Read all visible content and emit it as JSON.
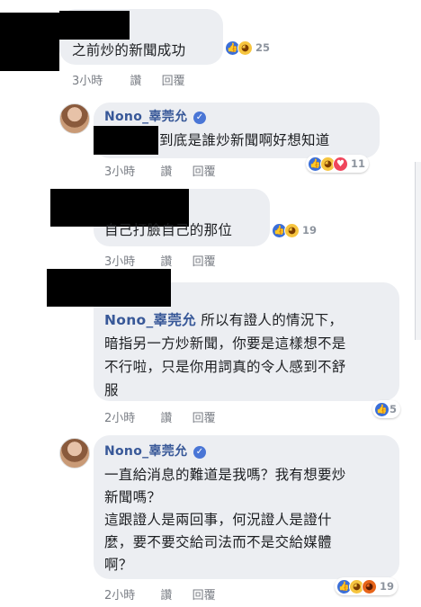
{
  "comments": [
    {
      "text": "之前炒的新聞成功",
      "time": "3小時",
      "like": "讚",
      "reply": "回覆",
      "reactions": [
        "like-icon",
        "haha-icon"
      ],
      "reaction_count": "25"
    },
    {
      "author": "Nono_辜莞允",
      "text": "到底是誰炒新聞啊好想知道",
      "time": "3小時",
      "like": "讚",
      "reply": "回覆",
      "reactions": [
        "like-icon",
        "haha-icon",
        "love-icon"
      ],
      "reaction_count": "11"
    },
    {
      "text": "自己打臉自己的那位",
      "time": "3小時",
      "like": "讚",
      "reply": "回覆",
      "reactions": [
        "like-icon",
        "haha-icon"
      ],
      "reaction_count": "19"
    },
    {
      "author": "Nono_辜莞允",
      "lines": [
        "所以有證人的情況下，",
        "暗指另一方炒新聞，你要是這樣想不是",
        "不行啦，只是你用詞真的令人感到不舒",
        "服"
      ],
      "time": "2小時",
      "like": "讚",
      "reply": "回覆",
      "reactions": [
        "like-icon"
      ],
      "reaction_count": "5"
    },
    {
      "author": "Nono_辜莞允",
      "lines": [
        "一直給消息的難道是我嗎？我有想要炒",
        "新聞嗎？",
        "這跟證人是兩回事，何況證人是證什",
        "麼，要不要交給司法而不是交給媒體",
        "啊？"
      ],
      "time": "2小時",
      "like": "讚",
      "reply": "回覆",
      "reactions": [
        "like-icon",
        "haha-icon",
        "angry-icon"
      ],
      "reaction_count": "19"
    }
  ],
  "colors": {
    "bubble": "#eceef2",
    "name": "#385898",
    "meta": "#7a7e85",
    "like": "#3b6fd8"
  }
}
